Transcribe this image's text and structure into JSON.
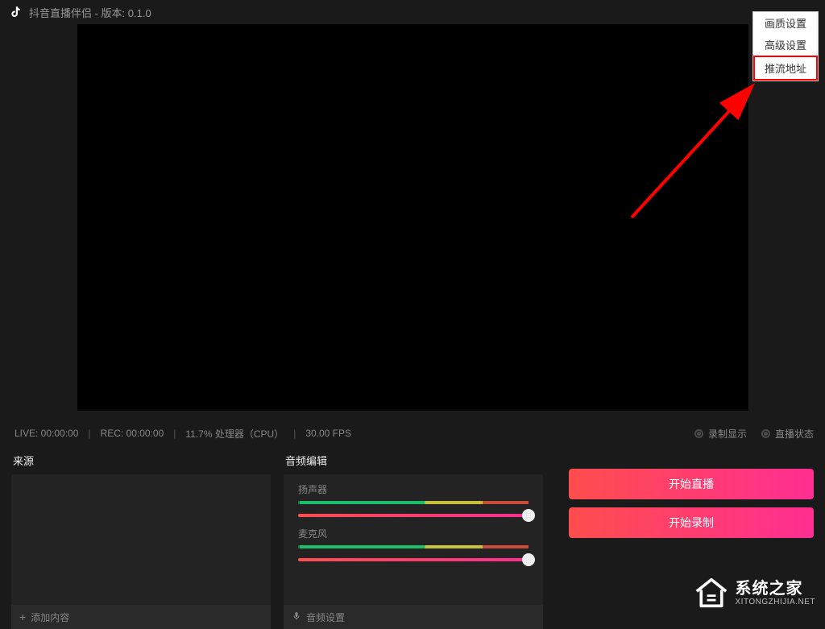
{
  "titlebar": {
    "title": "抖音直播伴侣 - 版本: 0.1.0"
  },
  "dropdown": {
    "items": [
      {
        "label": "画质设置"
      },
      {
        "label": "高级设置"
      },
      {
        "label": "推流地址"
      }
    ]
  },
  "statusbar": {
    "live": "LIVE: 00:00:00",
    "rec": "REC: 00:00:00",
    "cpu": "11.7% 处理器（CPU）",
    "fps": "30.00 FPS",
    "record_display": "录制显示",
    "stream_status": "直播状态"
  },
  "sources": {
    "title": "来源",
    "add_label": "添加内容"
  },
  "audio": {
    "title": "音频编辑",
    "speaker_label": "扬声器",
    "mic_label": "麦克风",
    "settings_label": "音频设置"
  },
  "actions": {
    "start_stream": "开始直播",
    "start_record": "开始录制"
  },
  "watermark": {
    "cn": "系统之家",
    "en": "XITONGZHIJIA.NET"
  }
}
